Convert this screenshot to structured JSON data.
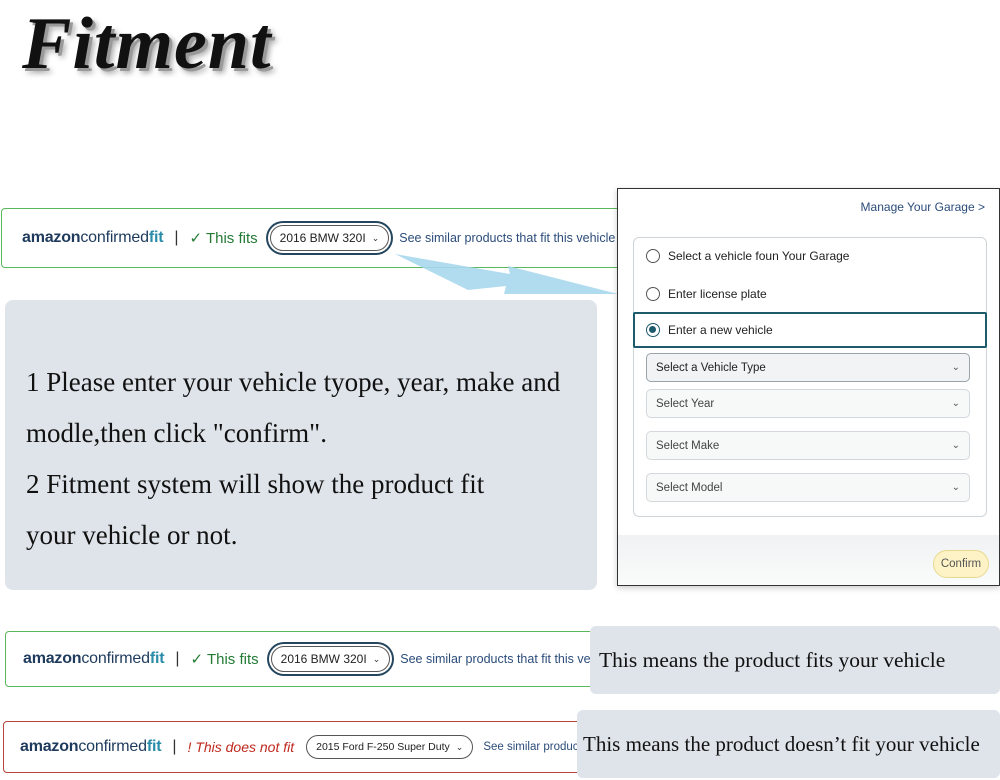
{
  "title": "Fitment",
  "brand": {
    "amazon": "amazon",
    "confirmed": "confirmed",
    "fit": "fit"
  },
  "separator": "|",
  "similar_text": "See similar products that fit this vehicle",
  "bar_top": {
    "status": "✓ This fits",
    "vehicle": "2016 BMW 320I",
    "similar": "See similar products that fit this vehicle",
    "similar_arrow": ">"
  },
  "bar_fits": {
    "status": "✓ This fits",
    "vehicle": "2016 BMW 320I",
    "similar": "See similar products that fit this vehicle",
    "similar_arrow": ">"
  },
  "bar_notfit": {
    "status": "! This does not fit",
    "vehicle": "2015 Ford F-250 Super Duty",
    "similar": "See similar products that fit this",
    "similar_arrow": ""
  },
  "instructions": {
    "line1": "1 Please enter your vehicle tyope, year, make and",
    "line2": "modle,then click \"confirm\".",
    "line3": "2  Fitment system will show the product fit",
    "line4": "your vehicle or not."
  },
  "modal": {
    "manage_garage": "Manage Your Garage",
    "manage_garage_arrow": ">",
    "options": [
      {
        "label": "Select a vehicle foun Your Garage",
        "selected": false
      },
      {
        "label": "Enter license plate",
        "selected": false
      },
      {
        "label": "Enter a new vehicle",
        "selected": true
      }
    ],
    "selects": [
      {
        "placeholder": "Select a Vehicle Type"
      },
      {
        "placeholder": "Select Year"
      },
      {
        "placeholder": "Select Make"
      },
      {
        "placeholder": "Select Model"
      }
    ],
    "confirm_label": "Confirm"
  },
  "captions": {
    "fits": "This means the product fits your vehicle",
    "not_fits": "This means the product doesn’t fit your vehicle"
  },
  "colors": {
    "fit_border": "#58b85b",
    "notfit_border": "#b8443c",
    "fit_status": "#237a35",
    "notfit_status": "#c0281e",
    "panel_bg": "#dfe4ea",
    "accent": "#1d5a6b"
  },
  "icons": {
    "check": "check-icon",
    "chevron": "chevron-down-icon",
    "arrow": "pointer-arrow"
  }
}
